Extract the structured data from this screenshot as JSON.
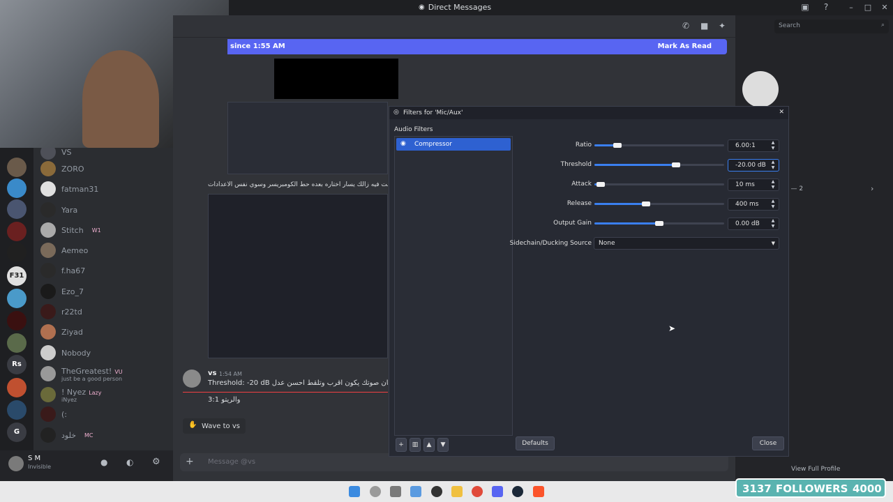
{
  "window": {
    "title": "Direct Messages",
    "search_placeholder": "Search"
  },
  "servers": [
    {
      "label": "F31"
    },
    {
      "label": "Rs"
    },
    {
      "label": "G"
    }
  ],
  "dm_list": {
    "items": [
      {
        "name": "VS",
        "badge": ""
      },
      {
        "name": "ZORO",
        "badge": ""
      },
      {
        "name": "fatman31",
        "badge": ""
      },
      {
        "name": "Yara",
        "badge": ""
      },
      {
        "name": "Stitch",
        "badge": "W1"
      },
      {
        "name": "Aemeo",
        "badge": ""
      },
      {
        "name": "f.ha67",
        "badge": ""
      },
      {
        "name": "Ezo_7",
        "badge": ""
      },
      {
        "name": "r22td",
        "badge": ""
      },
      {
        "name": "Ziyad",
        "badge": ""
      },
      {
        "name": "Nobody",
        "badge": ""
      },
      {
        "name": "TheGreatest!",
        "badge": "VU",
        "sub": "just be a good person"
      },
      {
        "name": "! Nyez",
        "badge": "Lazy",
        "sub": "iNyez"
      },
      {
        "name": "(:",
        "badge": ""
      },
      {
        "name": "خلود",
        "badge": "MC"
      }
    ]
  },
  "user_bar": {
    "name": "S M",
    "status": "Invisible"
  },
  "chat": {
    "new_messages_banner": "since 1:55 AM",
    "mark_as_read": "Mark As Read",
    "arabic_line_1": "ا روح تحت فيه زالك يسار اختاره بعده حط الكومبريسر وسوي نفس الاعدادات",
    "message": {
      "author": "vs",
      "time": "1:54 AM",
      "line1": "Threshold: -20 dB عشان صوتك يكون اقرب وتلقط احسن عدل",
      "line2": "3:1 والريتو"
    },
    "wave_button": "Wave to vs",
    "input_placeholder": "Message @vs"
  },
  "right_panel": {
    "group_label": "s — 2",
    "view_profile": "View Full Profile"
  },
  "obs_dialog": {
    "title": "Filters for 'Mic/Aux'",
    "section": "Audio Filters",
    "filter_name": "Compressor",
    "params": [
      {
        "label": "Ratio",
        "value": "6.00:1",
        "level": 0.18
      },
      {
        "label": "Threshold",
        "value": "-20.00 dB",
        "level": 0.63
      },
      {
        "label": "Attack",
        "value": "10 ms",
        "level": 0.05
      },
      {
        "label": "Release",
        "value": "400 ms",
        "level": 0.4
      },
      {
        "label": "Output Gain",
        "value": "0.00 dB",
        "level": 0.5
      }
    ],
    "sidechain_label": "Sidechain/Ducking Source",
    "sidechain_value": "None",
    "defaults": "Defaults",
    "close": "Close"
  },
  "overlay": {
    "followers_count": "3137",
    "followers_label": "FOLLOWERS",
    "goal": "4000"
  }
}
